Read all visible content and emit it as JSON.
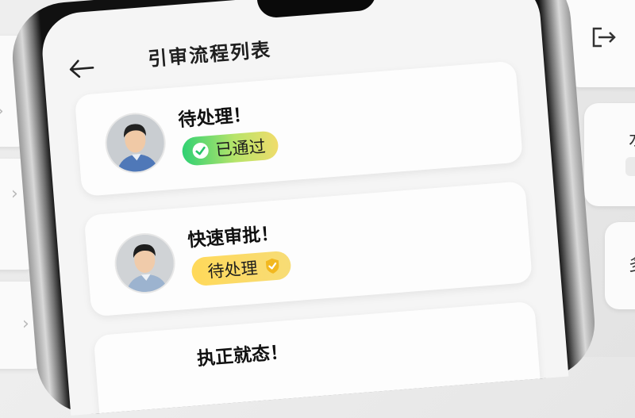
{
  "header": {
    "title": "引审流程列表"
  },
  "cards": [
    {
      "title": "待处理！",
      "status": "已通过",
      "status_kind": "approved",
      "avatar": "user-avatar"
    },
    {
      "title": "快速审批！",
      "status": "待处理",
      "status_kind": "pending",
      "avatar": "user-avatar"
    },
    {
      "title": "执正就态！",
      "status": "",
      "status_kind": "",
      "avatar": ""
    }
  ],
  "colors": {
    "approved_start": "#2fd173",
    "approved_end": "#f0dc6b",
    "pending": "#ffd95a",
    "shield": "#f2b81f"
  },
  "right_panel": {
    "letters": [
      "水",
      "多"
    ]
  }
}
